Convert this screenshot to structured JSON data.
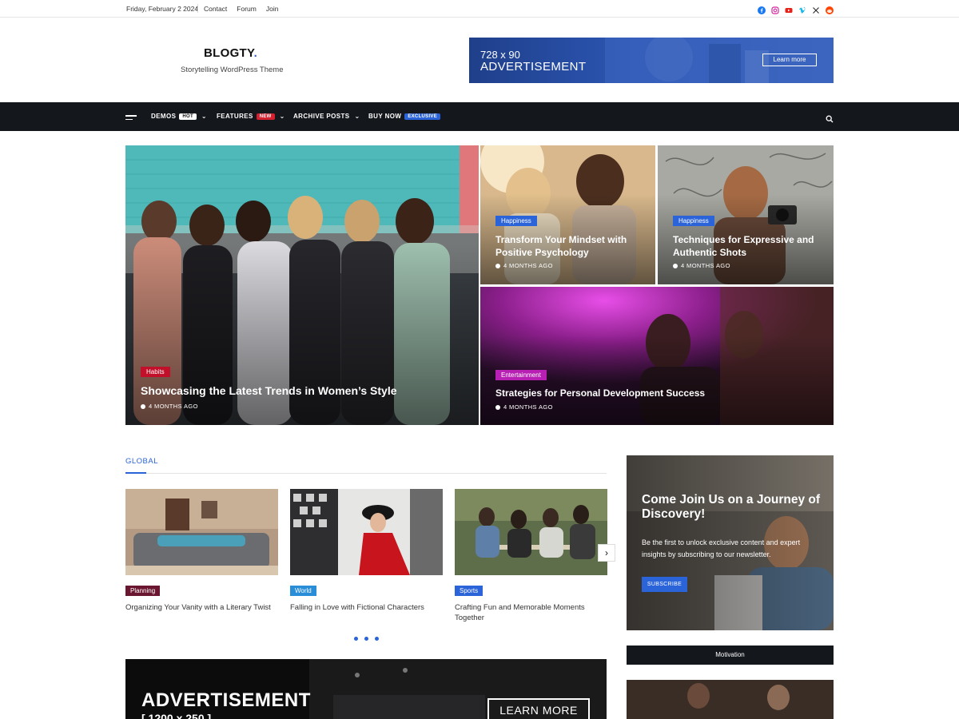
{
  "topbar": {
    "date": "Friday, February 2 2024",
    "links": [
      "Contact",
      "Forum",
      "Join"
    ],
    "social_icons": [
      "facebook-icon",
      "instagram-icon",
      "youtube-icon",
      "vimeo-icon",
      "x-icon",
      "reddit-icon"
    ]
  },
  "header": {
    "logo": "BLOGTY",
    "logo_dot": ".",
    "tagline": "Storytelling WordPress Theme",
    "ad": {
      "size": "728 x 90",
      "label": "ADVERTISEMENT",
      "button": "Learn more"
    }
  },
  "nav": {
    "items": [
      {
        "label": "DEMOS",
        "badge": "HOT",
        "badge_color": "#ffffff",
        "badge_text_color": "#111111"
      },
      {
        "label": "FEATURES",
        "badge": "NEW",
        "badge_color": "#d6202f",
        "badge_text_color": "#ffffff"
      },
      {
        "label": "ARCHIVE POSTS",
        "badge": "",
        "badge_color": "",
        "badge_text_color": ""
      },
      {
        "label": "BUY NOW",
        "badge": "EXCLUSIVE",
        "badge_color": "#2b63d9",
        "badge_text_color": "#ffffff"
      }
    ]
  },
  "hero": {
    "main": {
      "category": "Habits",
      "category_color": "#c2102b",
      "title": "Showcasing the Latest Trends in Women’s Style",
      "time": "4 MONTHS AGO"
    },
    "top_left": {
      "category": "Happiness",
      "category_color": "#2b63d9",
      "title": "Transform Your Mindset with Positive Psychology",
      "time": "4 MONTHS AGO"
    },
    "top_right": {
      "category": "Happiness",
      "category_color": "#2b63d9",
      "title": "Techniques for Expressive and Authentic Shots",
      "time": "4 MONTHS AGO"
    },
    "bottom": {
      "category": "Entertainment",
      "category_color": "#b81fb3",
      "title": "Strategies for Personal Development Success",
      "time": "4 MONTHS AGO"
    }
  },
  "global": {
    "title": "GLOBAL",
    "cards": [
      {
        "category": "Planning",
        "category_color": "#6b1630",
        "title": "Organizing Your Vanity with a Literary Twist"
      },
      {
        "category": "World",
        "category_color": "#2a8dd8",
        "title": "Falling in Love with Fictional Characters"
      },
      {
        "category": "Sports",
        "category_color": "#2b63d9",
        "title": "Crafting Fun and Memorable Moments Together"
      }
    ],
    "next": "›"
  },
  "bottom_ad": {
    "title": "ADVERTISEMENT",
    "size": "[ 1200 x 250 ]",
    "button": "LEARN MORE"
  },
  "sidebar": {
    "join_title": "Come Join Us on a Journey of Discovery!",
    "join_text": "Be the first to unlock exclusive content and expert insights by subscribing to our newsletter.",
    "join_button": "SUBSCRIBE",
    "motivation_label": "Motivation"
  },
  "colors": {
    "accent": "#2b63d9",
    "nav_bg": "#14171c"
  }
}
